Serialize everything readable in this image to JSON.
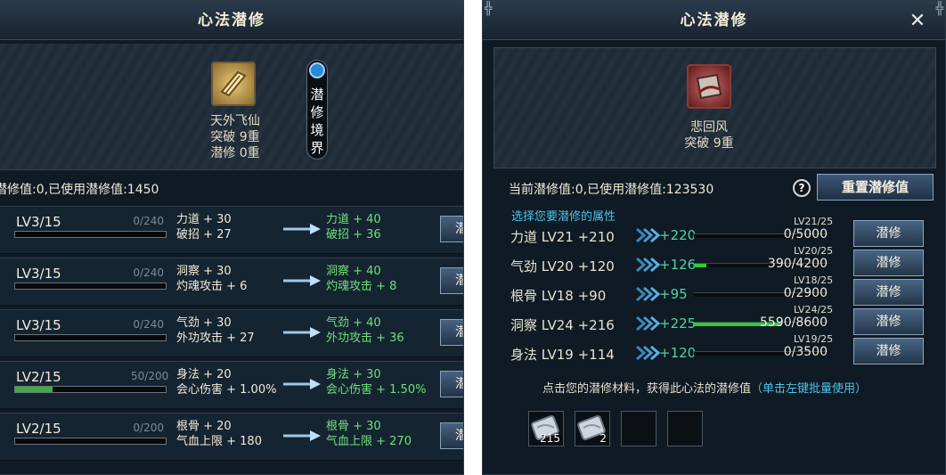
{
  "left": {
    "title": "心法潜修",
    "item": {
      "name": "天外飞仙",
      "breakthrough": "突破 9重",
      "cultivation": "潜修 0重"
    },
    "realm_button": "潜修境界",
    "value_line": "潜修值:0,已使用潜修值:1450",
    "rows": [
      {
        "level": "LV3/15",
        "progress": "0/240",
        "fill": 0,
        "cur1": "力道 + 30",
        "cur2": "破招 + 27",
        "next1": "力道 + 40",
        "next2": "破招 + 36",
        "btn": "潜"
      },
      {
        "level": "LV3/15",
        "progress": "0/240",
        "fill": 0,
        "cur1": "洞察 + 30",
        "cur2": "灼魂攻击 + 6",
        "next1": "洞察 + 40",
        "next2": "灼魂攻击 + 8",
        "btn": "潜"
      },
      {
        "level": "LV3/15",
        "progress": "0/240",
        "fill": 0,
        "cur1": "气劲 + 30",
        "cur2": "外功攻击 + 27",
        "next1": "气劲 + 40",
        "next2": "外功攻击 + 36",
        "btn": "潜"
      },
      {
        "level": "LV2/15",
        "progress": "50/200",
        "fill": 0.25,
        "cur1": "身法 + 20",
        "cur2": "会心伤害 + 1.00%",
        "next1": "身法 + 30",
        "next2": "会心伤害 + 1.50%",
        "btn": "潜"
      },
      {
        "level": "LV2/15",
        "progress": "0/200",
        "fill": 0,
        "cur1": "根骨 + 20",
        "cur2": "气血上限 + 180",
        "next1": "根骨 + 30",
        "next2": "气血上限 + 270",
        "btn": "潜"
      }
    ]
  },
  "right": {
    "title": "心法潜修",
    "close": "✕",
    "item": {
      "name": "悲回风",
      "breakthrough": "突破 9重"
    },
    "value_line": "当前潜修值:0,已使用潜修值:123530",
    "help": "?",
    "reset_button": "重置潜修值",
    "hint": "选择您要潜修的属性",
    "rows": [
      {
        "name": "力道 LV21 +210",
        "add": "+220",
        "count": "0/5000",
        "fill": 0,
        "lv": "LV21/25",
        "btn": "潜修"
      },
      {
        "name": "气劲 LV20 +120",
        "add": "+126",
        "count": "390/4200",
        "fill": 0.093,
        "lv": "LV20/25",
        "btn": "潜修"
      },
      {
        "name": "根骨 LV18 +90",
        "add": "+95",
        "count": "0/2900",
        "fill": 0,
        "lv": "LV18/25",
        "btn": "潜修"
      },
      {
        "name": "洞察 LV24 +216",
        "add": "+225",
        "count": "5590/8600",
        "fill": 0.65,
        "lv": "LV24/25",
        "btn": "潜修"
      },
      {
        "name": "身法 LV19 +114",
        "add": "+120",
        "count": "0/3500",
        "fill": 0,
        "lv": "LV19/25",
        "btn": "潜修"
      }
    ],
    "materials_text": "点击您的潜修材料，获得此心法的潜修值",
    "materials_highlight": "（单击左键批量使用）",
    "materials": [
      {
        "count": "215"
      },
      {
        "count": "2"
      },
      {
        "count": ""
      },
      {
        "count": ""
      }
    ]
  },
  "colors": {
    "accent_green": "#6fe07a",
    "highlight_blue": "#4fc2e8",
    "progress_green": "#3fae3c"
  }
}
